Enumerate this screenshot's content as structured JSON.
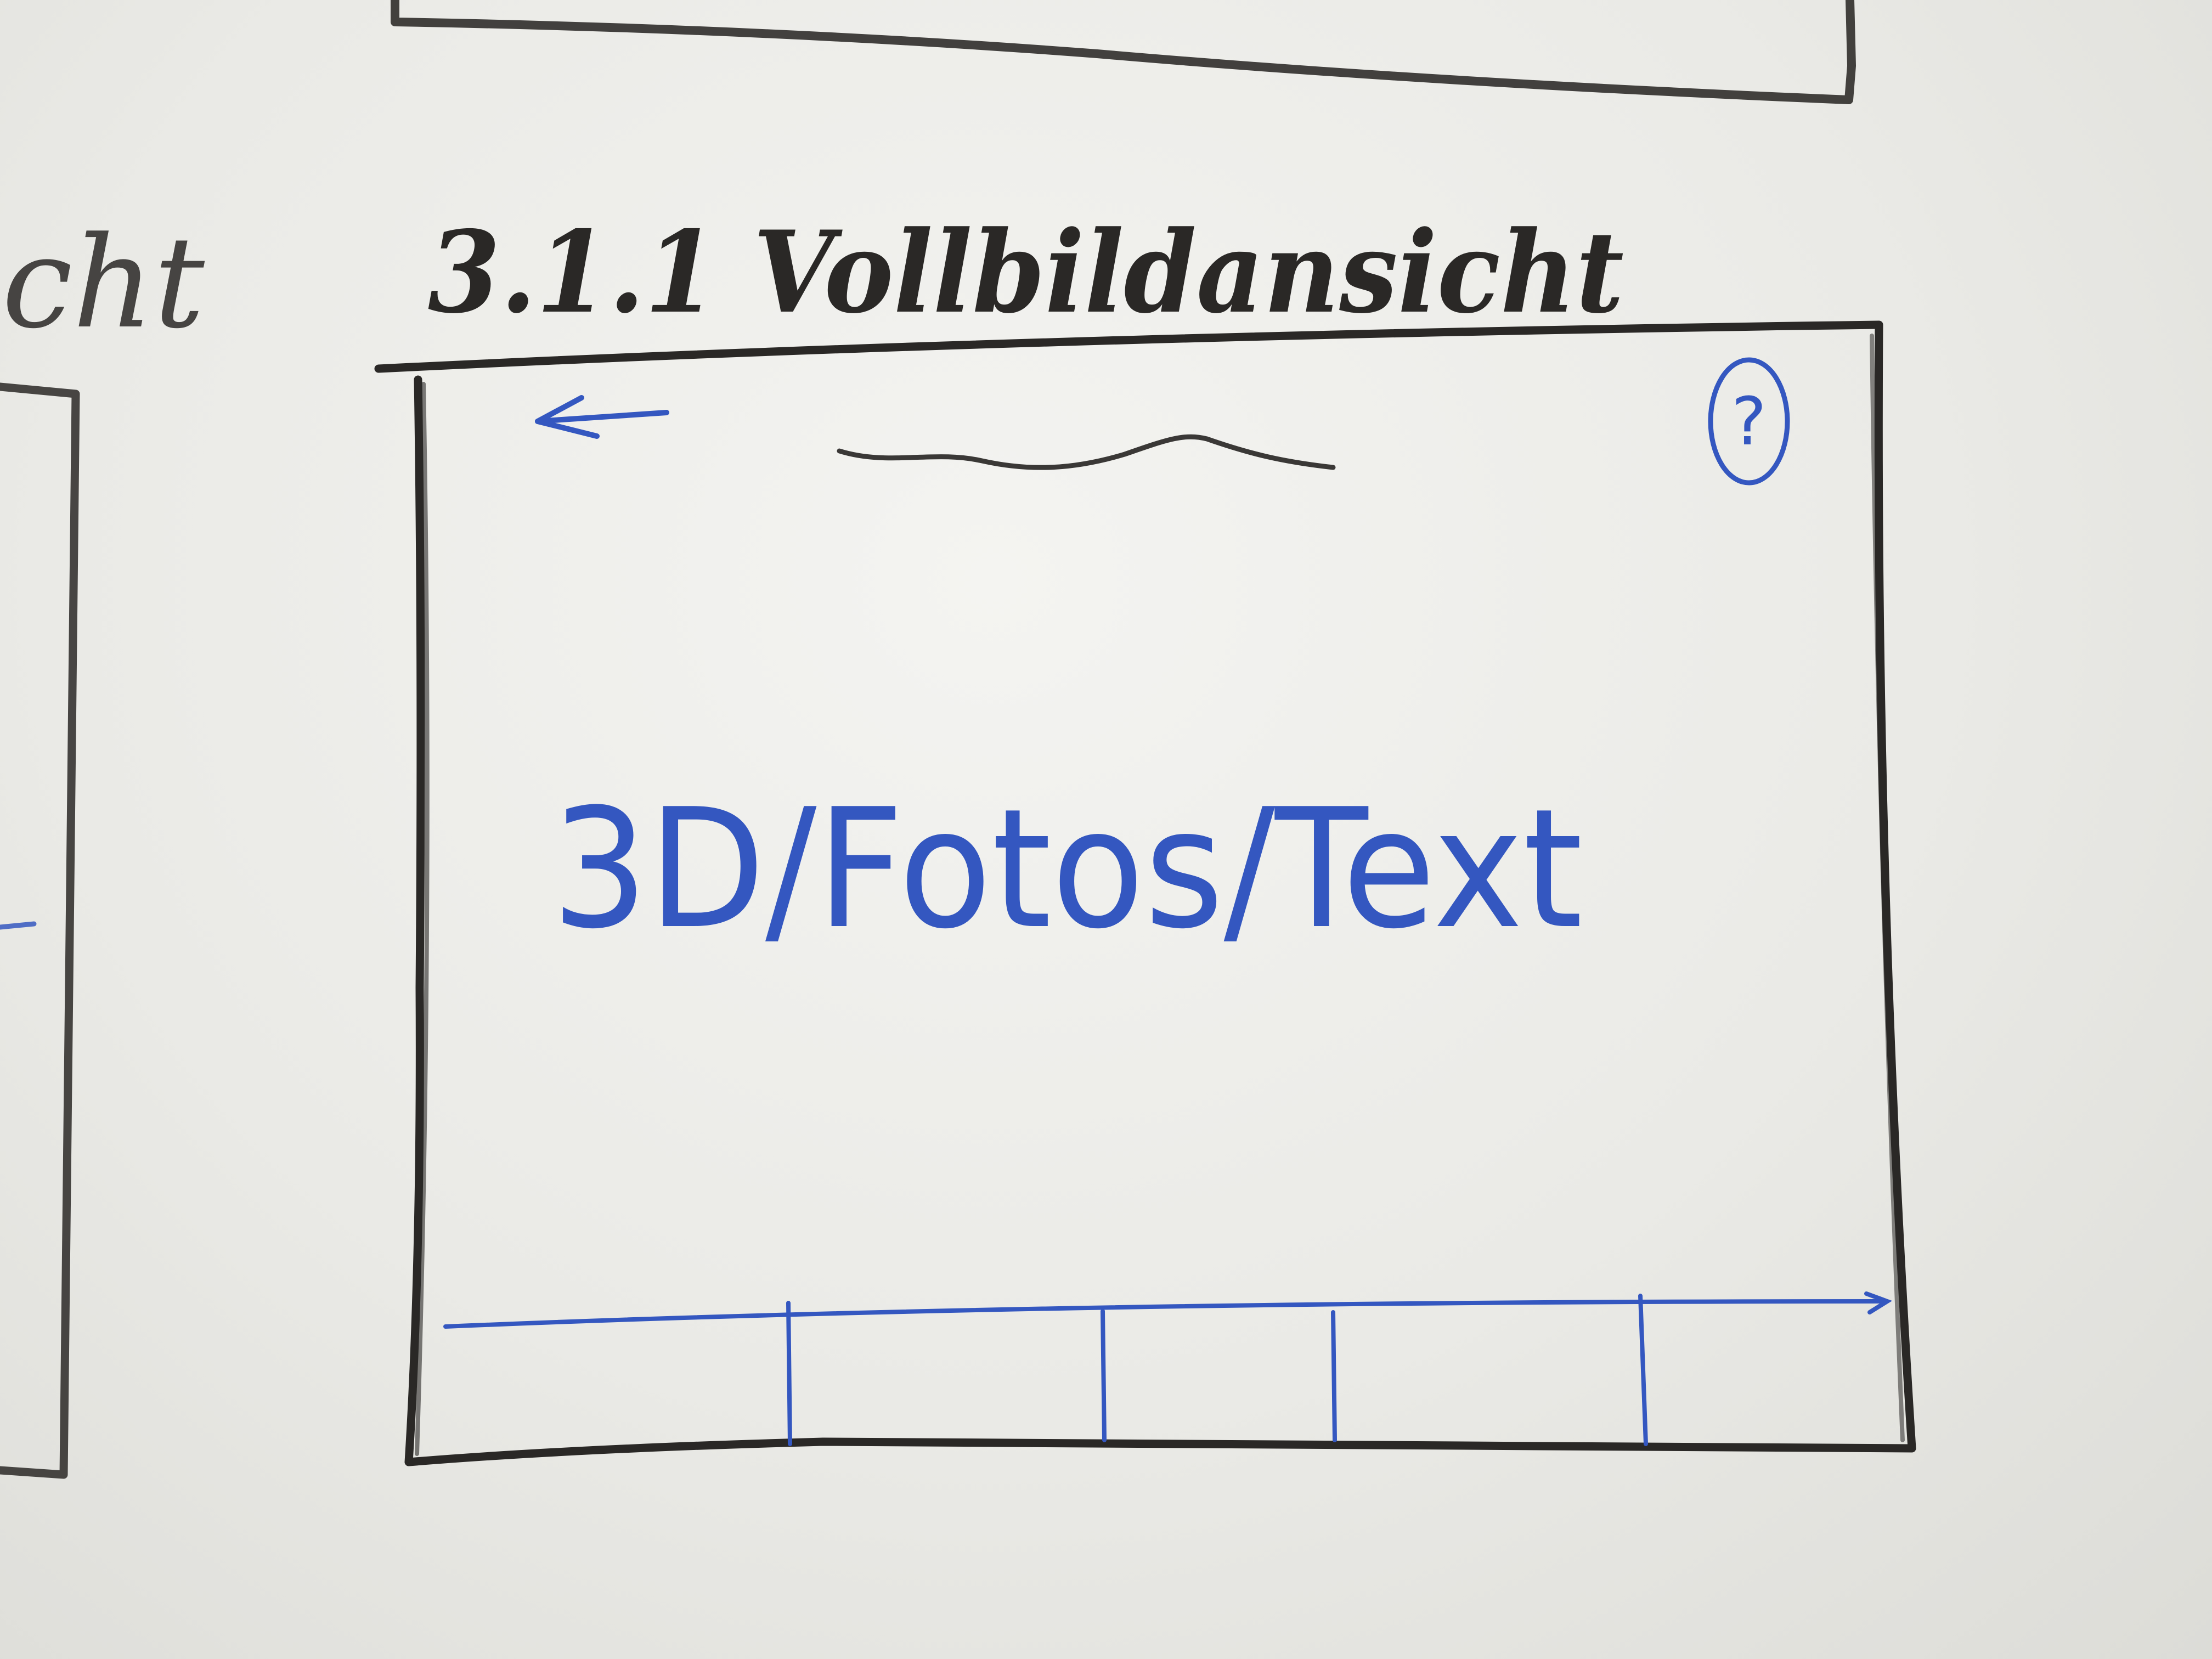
{
  "colors": {
    "board_background": "#ebebe7",
    "black_marker": "#2a2826",
    "blue_marker": "#3457c0"
  },
  "partial_left_heading": "icht",
  "section_heading": "3.1.1 Vollbildansicht",
  "frame": {
    "back_icon": "left-arrow-icon",
    "title_placeholder": "wavy-line",
    "help_icon_label": "?",
    "content_label": "3D/Fotos/Text",
    "bottom_bar": {
      "segments": [
        "",
        "",
        "",
        "",
        ""
      ]
    }
  }
}
